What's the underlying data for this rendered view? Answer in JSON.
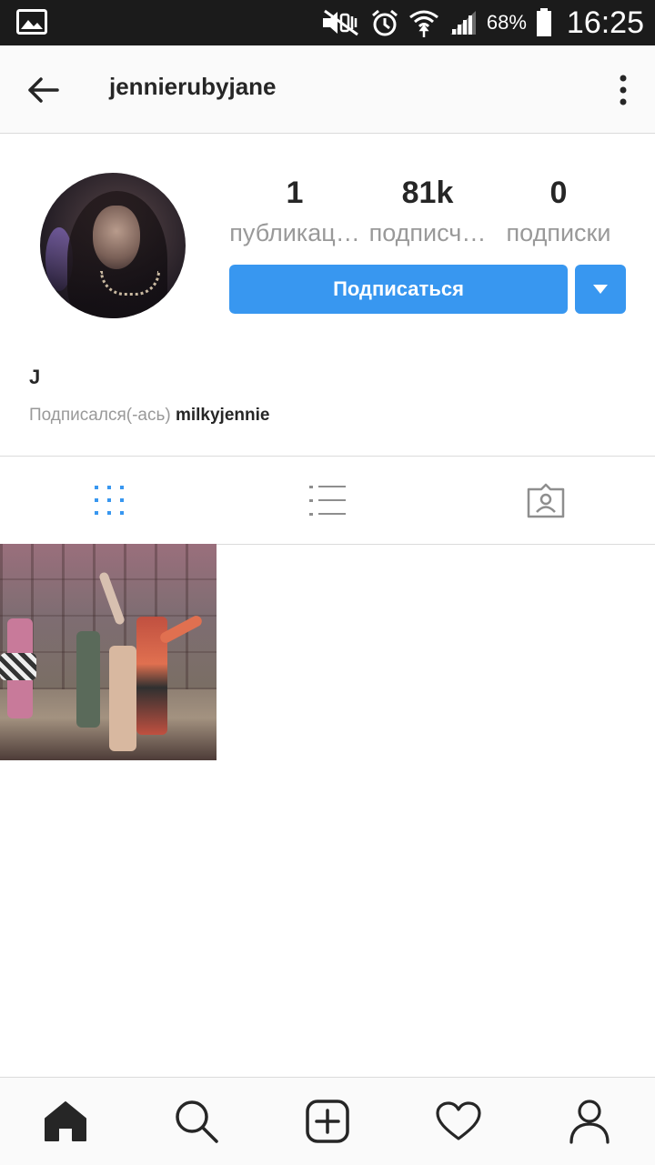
{
  "status_bar": {
    "battery_percent": "68%",
    "time": "16:25"
  },
  "app_bar": {
    "title": "jennierubyjane"
  },
  "profile": {
    "stats": [
      {
        "value": "1",
        "label": "публикац…"
      },
      {
        "value": "81k",
        "label": "подписч…"
      },
      {
        "value": "0",
        "label": "подписки"
      }
    ],
    "follow_label": "Подписаться",
    "name": "J",
    "followed_by_prefix": "Подписался(-ась)",
    "followed_by_user": "milkyjennie"
  },
  "tabs": [
    {
      "icon": "grid-icon",
      "active": true
    },
    {
      "icon": "list-icon",
      "active": false
    },
    {
      "icon": "tagged-icon",
      "active": false
    }
  ],
  "posts_count_shown": 1,
  "bottom_nav": [
    "home-icon",
    "search-icon",
    "add-post-icon",
    "activity-heart-icon",
    "profile-icon"
  ],
  "colors": {
    "accent": "#3897f0",
    "text_primary": "#262626",
    "text_secondary": "#999999",
    "statusbar_bg": "#1b1b1b",
    "bar_bg": "#fafafa",
    "divider": "#dbdbdb"
  }
}
